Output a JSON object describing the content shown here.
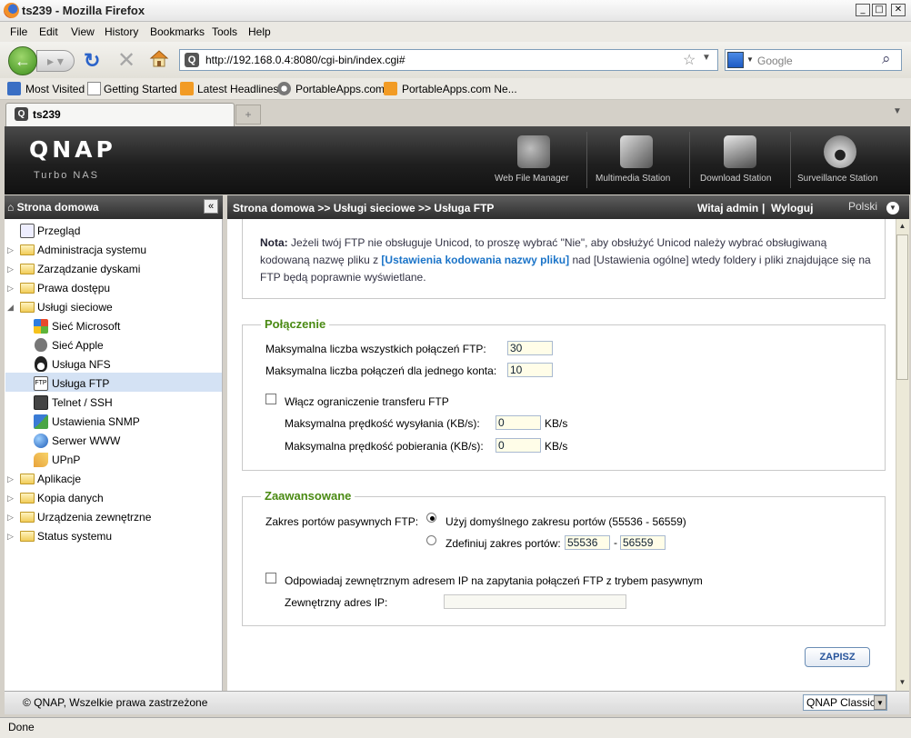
{
  "window": {
    "title": "ts239 - Mozilla Firefox",
    "controls": {
      "minimize": "_",
      "maximize": "□",
      "close": "✕"
    }
  },
  "menu": [
    "File",
    "Edit",
    "View",
    "History",
    "Bookmarks",
    "Tools",
    "Help"
  ],
  "nav": {
    "url": "http://192.168.0.4:8080/cgi-bin/index.cgi#",
    "search_placeholder": "Google"
  },
  "bookmarks": [
    "Most Visited",
    "Getting Started",
    "Latest Headlines",
    "PortableApps.com",
    "PortableApps.com Ne..."
  ],
  "tab": {
    "title": "ts239",
    "favicon": "Q"
  },
  "header": {
    "logo": "QNAP",
    "subtitle": "Turbo NAS",
    "apps": [
      "Web File Manager",
      "Multimedia Station",
      "Download Station",
      "Surveillance Station"
    ]
  },
  "sidebar": {
    "title": "Strona domowa",
    "items": [
      {
        "label": "Przegląd",
        "type": "leaf",
        "icon": "overview-icon"
      },
      {
        "label": "Administracja systemu",
        "type": "folder",
        "expanded": false
      },
      {
        "label": "Zarządzanie dyskami",
        "type": "folder",
        "expanded": false
      },
      {
        "label": "Prawa dostępu",
        "type": "folder",
        "expanded": false
      },
      {
        "label": "Usługi sieciowe",
        "type": "folder",
        "expanded": true
      },
      {
        "label": "Sieć Microsoft",
        "type": "child",
        "icon": "windows-icon"
      },
      {
        "label": "Sieć Apple",
        "type": "child",
        "icon": "apple-icon"
      },
      {
        "label": "Usługa NFS",
        "type": "child",
        "icon": "linux-icon"
      },
      {
        "label": "Usługa FTP",
        "type": "child",
        "icon": "ftp-icon",
        "selected": true
      },
      {
        "label": "Telnet / SSH",
        "type": "child",
        "icon": "terminal-icon"
      },
      {
        "label": "Ustawienia SNMP",
        "type": "child",
        "icon": "snmp-icon"
      },
      {
        "label": "Serwer WWW",
        "type": "child",
        "icon": "globe-icon"
      },
      {
        "label": "UPnP",
        "type": "child",
        "icon": "upnp-icon"
      },
      {
        "label": "Aplikacje",
        "type": "folder",
        "expanded": false
      },
      {
        "label": "Kopia danych",
        "type": "folder",
        "expanded": false
      },
      {
        "label": "Urządzenia zewnętrzne",
        "type": "folder",
        "expanded": false
      },
      {
        "label": "Status systemu",
        "type": "folder",
        "expanded": false
      }
    ]
  },
  "topbar": {
    "breadcrumb": "Strona domowa >> Usługi sieciowe >> Usługa FTP",
    "welcome": "Witaj admin",
    "separator": "|",
    "logout": "Wyloguj",
    "language": "Polski"
  },
  "note": {
    "label": "Nota:",
    "text1": " Jeżeli twój FTP nie obsługuje Unicod, to proszę wybrać \"Nie\", aby obsłużyć Unicod należy wybrać obsługiwaną kodowaną nazwę pliku z ",
    "link": "[Ustawienia kodowania nazwy pliku]",
    "text2": " nad [Ustawienia ogólne] wtedy foldery i pliki znajdujące się na FTP będą poprawnie wyświetlane."
  },
  "connection": {
    "title": "Połączenie",
    "max_all_label": "Maksymalna liczba wszystkich połączeń FTP:",
    "max_all_value": "30",
    "max_account_label": "Maksymalna liczba połączeń dla jednego konta:",
    "max_account_value": "10",
    "limit_label": "Włącz ograniczenie transferu FTP",
    "limit_checked": false,
    "upload_label": "Maksymalna prędkość wysyłania (KB/s):",
    "upload_value": "0",
    "download_label": "Maksymalna prędkość pobierania (KB/s):",
    "download_value": "0",
    "unit": "KB/s"
  },
  "advanced": {
    "title": "Zaawansowane",
    "passive_label": "Zakres portów pasywnych FTP:",
    "default_option": "Użyj domyślnego zakresu portów (55536 - 56559)",
    "custom_option": "Zdefiniuj zakres portów:",
    "port_from": "55536",
    "port_dash": "-",
    "port_to": "56559",
    "external_ip_checkbox": "Odpowiadaj zewnętrznym adresem IP na zapytania połączeń FTP z trybem pasywnym",
    "external_ip_label": "Zewnętrzny adres IP:",
    "external_ip_value": ""
  },
  "save_label": "ZAPISZ",
  "footer": {
    "copyright": "© QNAP, Wszelkie prawa zastrzeżone",
    "style": "QNAP Classic"
  },
  "status": "Done"
}
